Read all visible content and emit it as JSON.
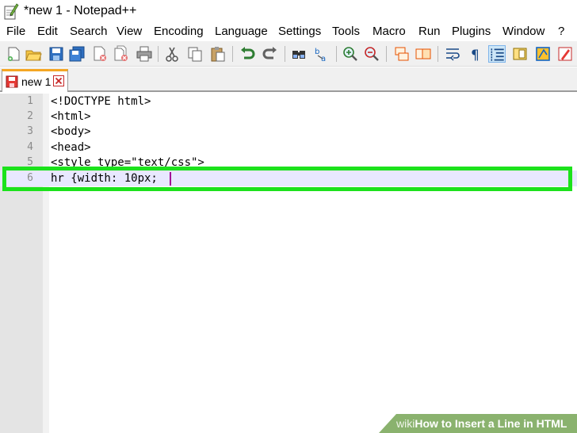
{
  "window": {
    "title": "*new 1 - Notepad++"
  },
  "menu": {
    "items": [
      "File",
      "Edit",
      "Search",
      "View",
      "Encoding",
      "Language",
      "Settings",
      "Tools",
      "Macro",
      "Run",
      "Plugins",
      "Window",
      "?"
    ]
  },
  "toolbar": {
    "icons": [
      "new-file-icon",
      "open-file-icon",
      "save-icon",
      "save-all-icon",
      "close-icon",
      "close-all-icon",
      "print-icon",
      "cut-icon",
      "copy-icon",
      "paste-icon",
      "undo-icon",
      "redo-icon",
      "find-icon",
      "replace-icon",
      "zoom-in-icon",
      "zoom-out-icon",
      "sync-vertical-icon",
      "sync-horizontal-icon",
      "word-wrap-icon",
      "show-all-characters-icon",
      "indent-guide-icon",
      "document-map-icon",
      "function-list-icon",
      "folder-workspace-icon"
    ],
    "active_icon": "indent-guide-icon"
  },
  "tabs": [
    {
      "label": "new 1",
      "modified": true
    }
  ],
  "editor": {
    "lines": [
      {
        "number": "1",
        "text": "<!DOCTYPE html>"
      },
      {
        "number": "2",
        "text": "<html>"
      },
      {
        "number": "3",
        "text": "<body>"
      },
      {
        "number": "4",
        "text": "<head>"
      },
      {
        "number": "5",
        "text": "<style type=\"text/css\">"
      },
      {
        "number": "6",
        "text": "hr {width: 10px;"
      }
    ],
    "current_line": 6,
    "highlight_color": "#1ce21c"
  },
  "watermark": {
    "brand": "wiki",
    "text": "How to Insert a Line in HTML"
  },
  "colors": {
    "tab_accent": "#f5a623",
    "current_line": "#e8e8ff",
    "caret": "#a20095",
    "gutter": "#e4e4e4"
  }
}
